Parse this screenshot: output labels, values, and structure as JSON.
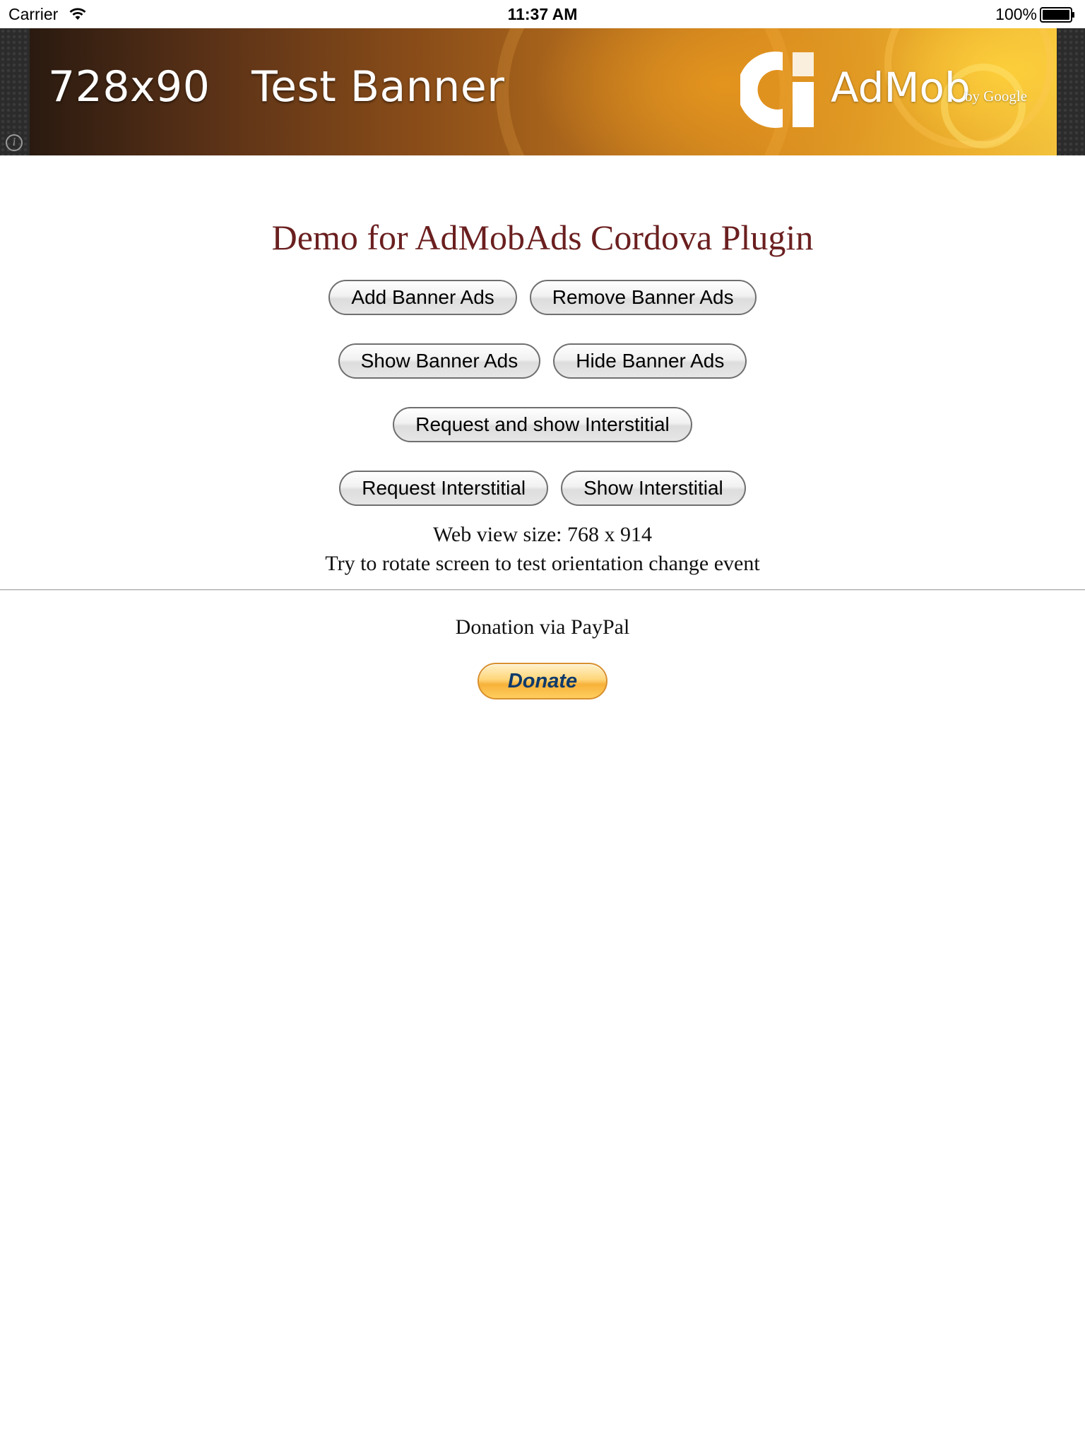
{
  "status_bar": {
    "carrier": "Carrier",
    "time": "11:37 AM",
    "battery": "100%",
    "icons": [
      "wifi-icon",
      "battery-icon"
    ]
  },
  "ad_banner": {
    "size_label": "728x90",
    "title": "Test Banner",
    "brand": "AdMob",
    "brand_sub": "by Google",
    "icons": [
      "admob-logo-icon",
      "info-icon"
    ],
    "colors": {
      "banner_orange": "#d48a20",
      "banner_dark": "#2a1a10"
    }
  },
  "page": {
    "title": "Demo for AdMobAds Cordova Plugin",
    "title_color": "#6b1f1f",
    "buttons": {
      "add_banner": "Add Banner Ads",
      "remove_banner": "Remove Banner Ads",
      "show_banner": "Show Banner Ads",
      "hide_banner": "Hide Banner Ads",
      "request_show_interstitial": "Request and show Interstitial",
      "request_interstitial": "Request Interstitial",
      "show_interstitial": "Show Interstitial"
    },
    "web_view_size": "Web view size: 768 x 914",
    "rotate_hint": "Try to rotate screen to test orientation change event",
    "donation_label": "Donation via PayPal",
    "donate_button": "Donate"
  }
}
